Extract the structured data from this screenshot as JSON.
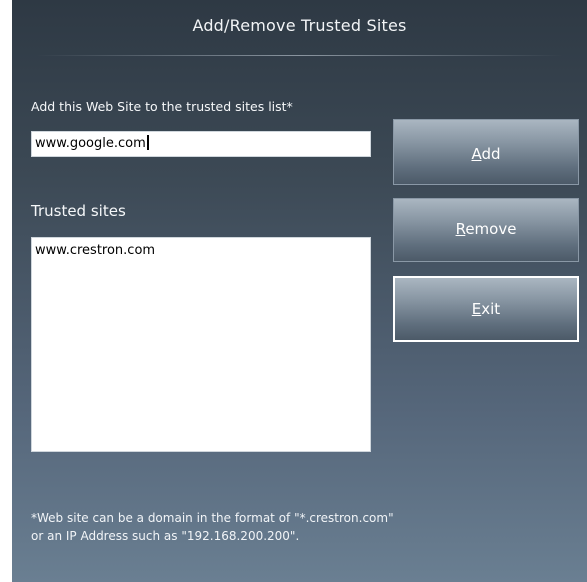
{
  "dialog": {
    "title": "Add/Remove Trusted Sites",
    "add_label": "Add this Web Site to the trusted sites list*",
    "input_value": "www.google.com",
    "trusted_label": "Trusted sites",
    "trusted_sites": [
      "www.crestron.com"
    ],
    "buttons": {
      "add": {
        "mnemonic": "A",
        "rest": "dd"
      },
      "remove": {
        "mnemonic": "R",
        "rest": "emove"
      },
      "exit": {
        "mnemonic": "E",
        "rest": "xit"
      }
    },
    "footnote": [
      "*Web site can be a domain in the format of \"*.crestron.com\"",
      "or an IP Address such as \"192.168.200.200\"."
    ]
  },
  "colors": {
    "background_top": "#2e3944",
    "background_bottom": "#6a7f92",
    "button_top": "#aab6c1",
    "button_bottom": "#4c5a68",
    "focus_border": "#ffffff"
  }
}
